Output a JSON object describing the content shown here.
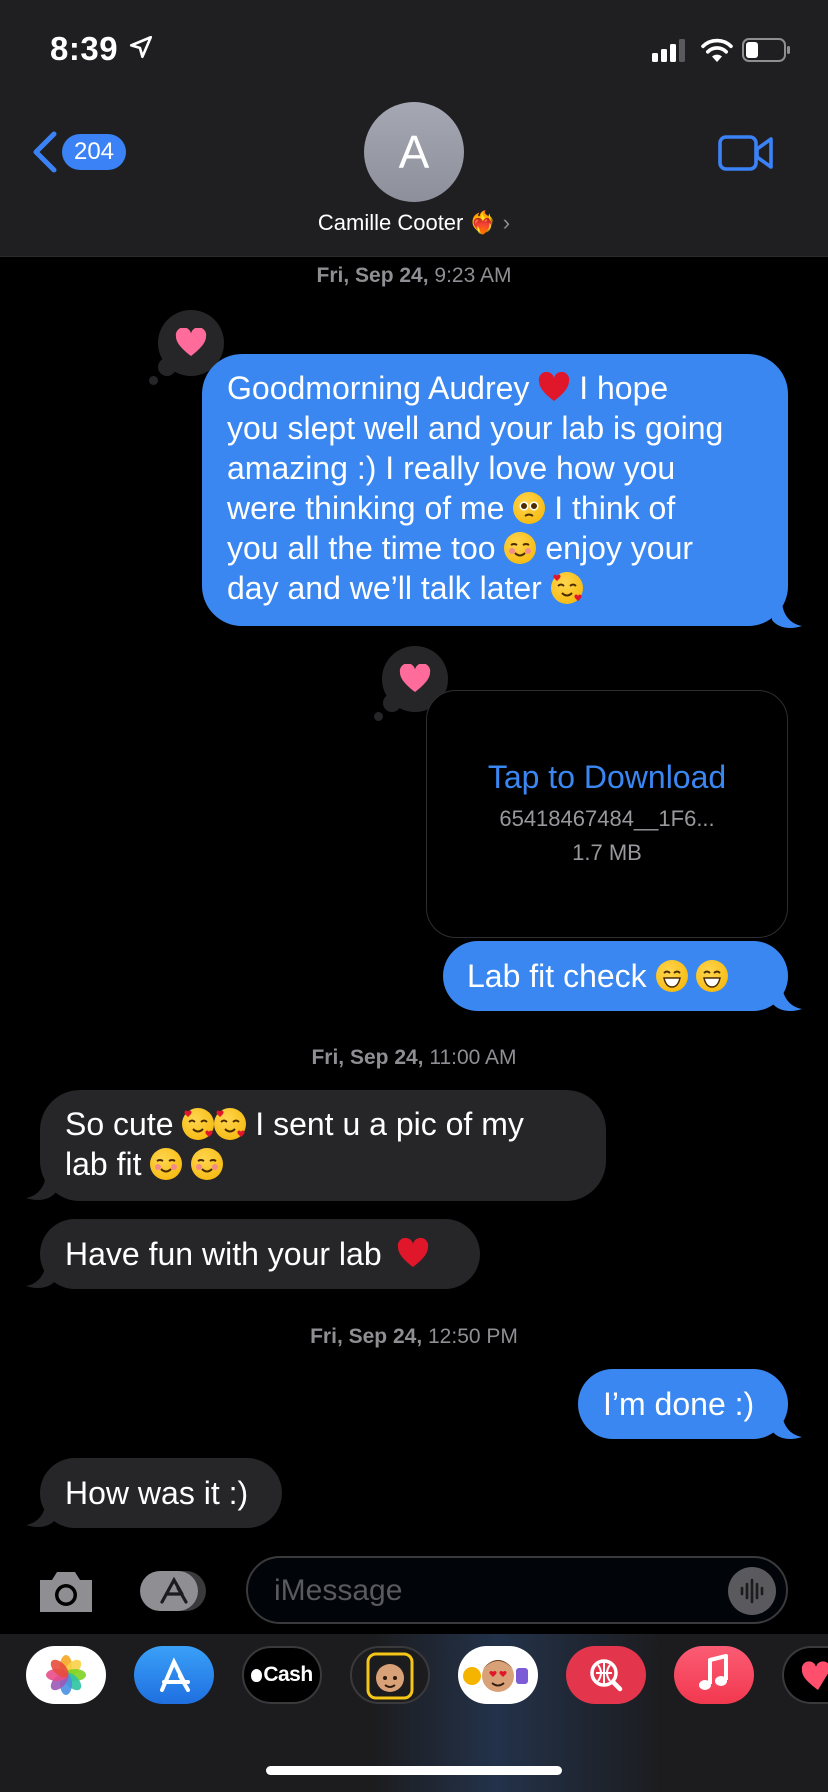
{
  "status_bar": {
    "time": "8:39"
  },
  "header": {
    "back_count": "204",
    "avatar_initial": "A",
    "contact_name": "Camille Cooter",
    "contact_emoji": "❤️‍🔥"
  },
  "messages": [
    {
      "type": "timestamp",
      "day": "Fri, Sep 24,",
      "time": "9:23 AM"
    },
    {
      "type": "sent",
      "lines": [
        "Goodmorning Audrey",
        "I hope",
        "you slept well and your lab is going",
        "amazing :) I really love how you",
        "were thinking of me",
        "I think of",
        "you all the time too",
        "enjoy your",
        "day and we’ll talk later"
      ],
      "tapback": "heart"
    },
    {
      "type": "attachment",
      "action": "Tap to Download",
      "filename": "65418467484__1F6...",
      "size": "1.7 MB",
      "tapback": "heart"
    },
    {
      "type": "sent",
      "text": "Lab fit check"
    },
    {
      "type": "timestamp",
      "day": "Fri, Sep 24,",
      "time": "11:00 AM"
    },
    {
      "type": "received",
      "line1a": "So cute",
      "line1b": "I sent u a pic of my",
      "line2": "lab fit"
    },
    {
      "type": "received",
      "text": "Have fun with your lab"
    },
    {
      "type": "timestamp",
      "day": "Fri, Sep 24,",
      "time": "12:50 PM"
    },
    {
      "type": "sent",
      "text": "I’m done :)"
    },
    {
      "type": "received",
      "text": "How was it :)"
    }
  ],
  "compose": {
    "placeholder": "iMessage"
  },
  "app_drawer": {
    "apps": [
      "photos-app",
      "app-store-app",
      "apple-cash-app",
      "memoji-app",
      "memoji-stickers-app",
      "web-images-app",
      "music-app",
      "digital-touch-app"
    ],
    "cash_label": "Cash"
  },
  "colors": {
    "sent_bubble": "#3a87f2",
    "received_bubble": "#262628",
    "background": "#000000",
    "accent": "#3b82f6",
    "tapback_heart": "#ff6b9a"
  }
}
